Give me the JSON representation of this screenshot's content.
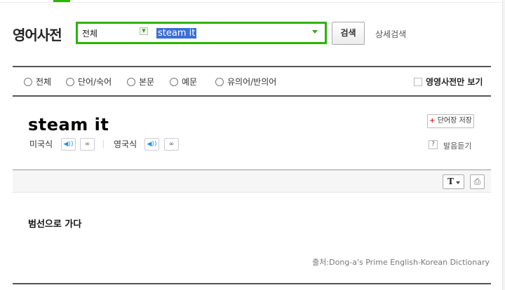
{
  "header": {
    "title": "영어사전",
    "accent_color": "#2db400"
  },
  "search": {
    "scope": "전체",
    "query": "steam  it",
    "button_label": "검색",
    "advanced_label": "상세검색"
  },
  "filters": {
    "options": [
      "전체",
      "단어/숙어",
      "본문",
      "예문",
      "유의어/반의어"
    ],
    "english_only_label": "영영사전만 보기"
  },
  "entry": {
    "headword": "steam it",
    "pronunciations": [
      {
        "label": "미국식",
        "speaker_icon": "speaker-icon",
        "repeat_icon": "repeat-icon"
      },
      {
        "label": "영국식",
        "speaker_icon": "speaker-icon",
        "repeat_icon": "repeat-icon"
      }
    ],
    "save_label": "단어장 저장",
    "listen_help": "?",
    "listen_label": "발음듣기",
    "meaning": "범선으로 가다",
    "source": "출처:Dong-a's Prime English-Korean Dictionary"
  },
  "toolbar": {
    "font_label": "T"
  }
}
